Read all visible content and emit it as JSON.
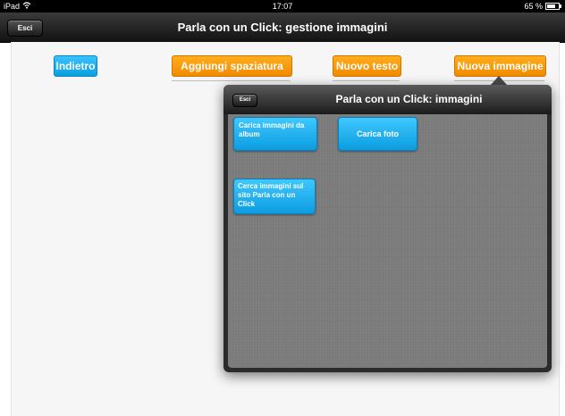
{
  "status_bar": {
    "device": "iPad",
    "wifi_icon": "wifi-icon",
    "time": "17:07",
    "battery": "65 %",
    "battery_icon": "battery-icon"
  },
  "nav": {
    "title": "Parla con un Click: gestione immagini",
    "exit_label": "Esci"
  },
  "toolbar": {
    "back_label": "Indietro",
    "add_spacing_label": "Aggiungi spaziatura",
    "new_text_label": "Nuovo testo",
    "new_image_label": "Nuova immagine"
  },
  "popover": {
    "title": "Parla con un Click: immagini",
    "exit_label": "Esci",
    "load_album_label": "Carica immagini da album",
    "load_photo_label": "Carica foto",
    "search_site_label": "Cerca immagini sul sito Parla con un Click"
  },
  "colors": {
    "blue_button": "#0a9fe0",
    "orange_button": "#f28a00",
    "nav_bar": "#1c1c1c",
    "popover_body": "#7a7a7a"
  }
}
